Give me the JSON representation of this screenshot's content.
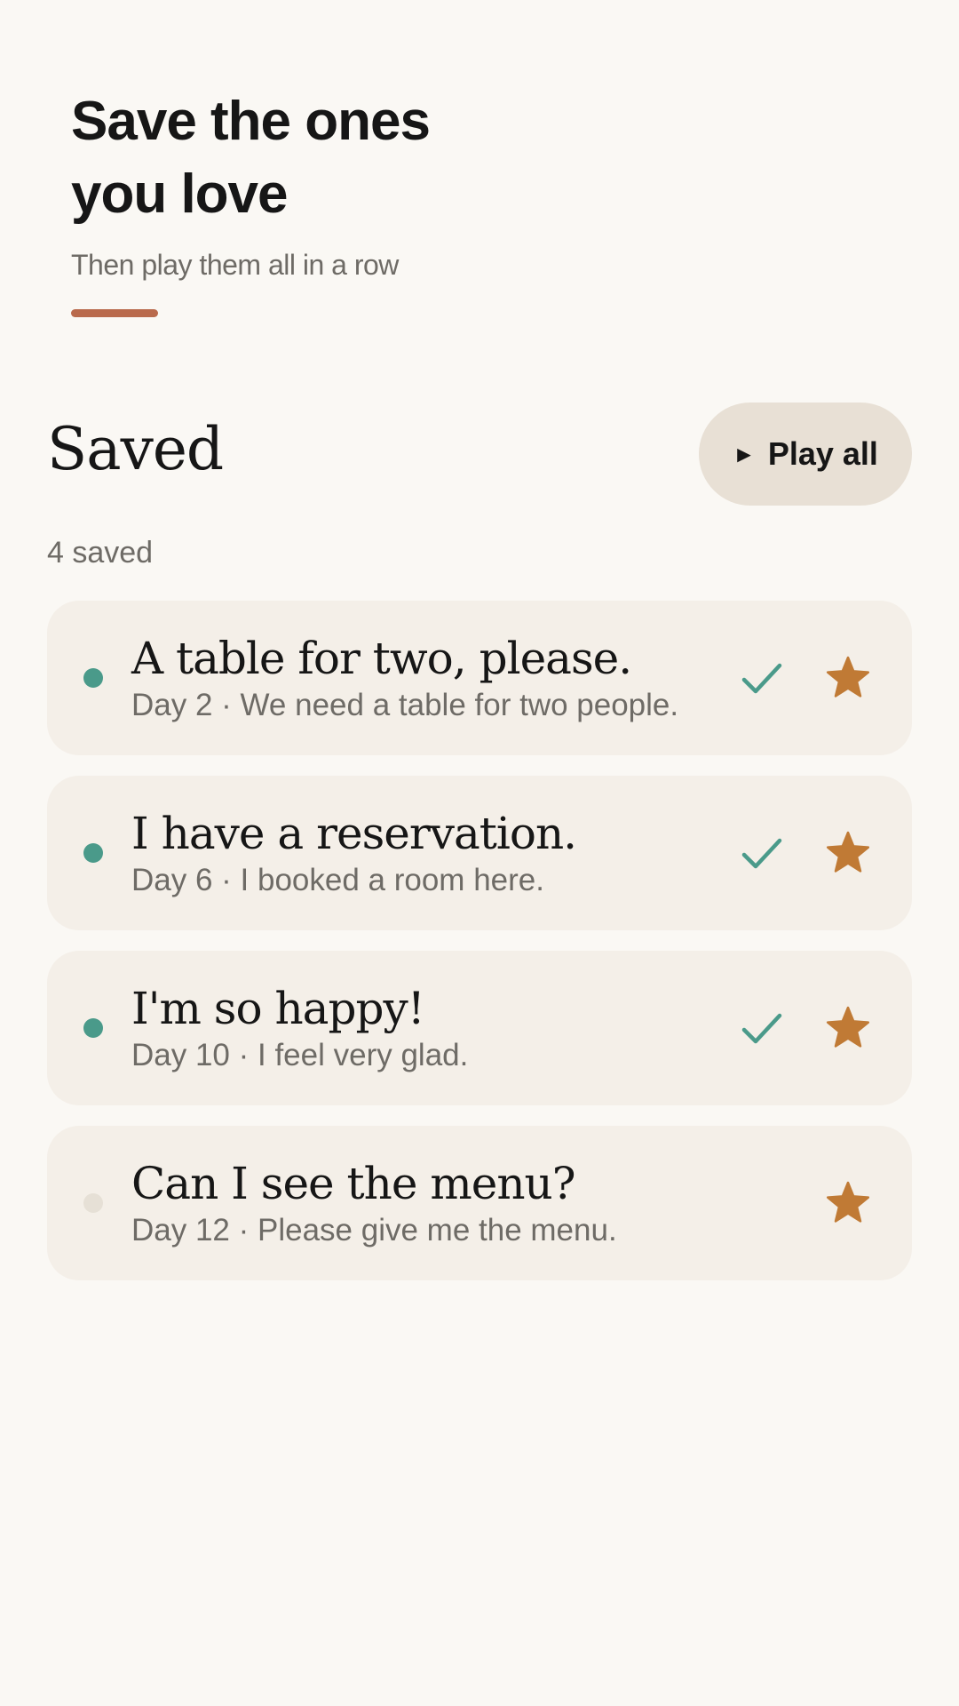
{
  "hero": {
    "title": "Save the ones\nyou love",
    "subtitle": "Then play them all in a row"
  },
  "section": {
    "title": "Saved",
    "count_label": "4 saved",
    "play_all_label": "Play all",
    "play_icon": "play-icon"
  },
  "colors": {
    "background": "#faf8f4",
    "accent": "#b96a4c",
    "card": "#f4efe8",
    "teal": "#4a9a8a",
    "star": "#c07a35",
    "dot_inactive": "#e6e0d6"
  },
  "items": [
    {
      "title": "A table for two, please.",
      "subtitle": "Day 2 · We need a table for two people.",
      "completed": true,
      "starred": true
    },
    {
      "title": "I have a reservation.",
      "subtitle": "Day 6 · I booked a room here.",
      "completed": true,
      "starred": true
    },
    {
      "title": "I'm so happy!",
      "subtitle": "Day 10 · I feel very glad.",
      "completed": true,
      "starred": true
    },
    {
      "title": "Can I see the menu?",
      "subtitle": "Day 12 · Please give me the menu.",
      "completed": false,
      "starred": true
    }
  ]
}
